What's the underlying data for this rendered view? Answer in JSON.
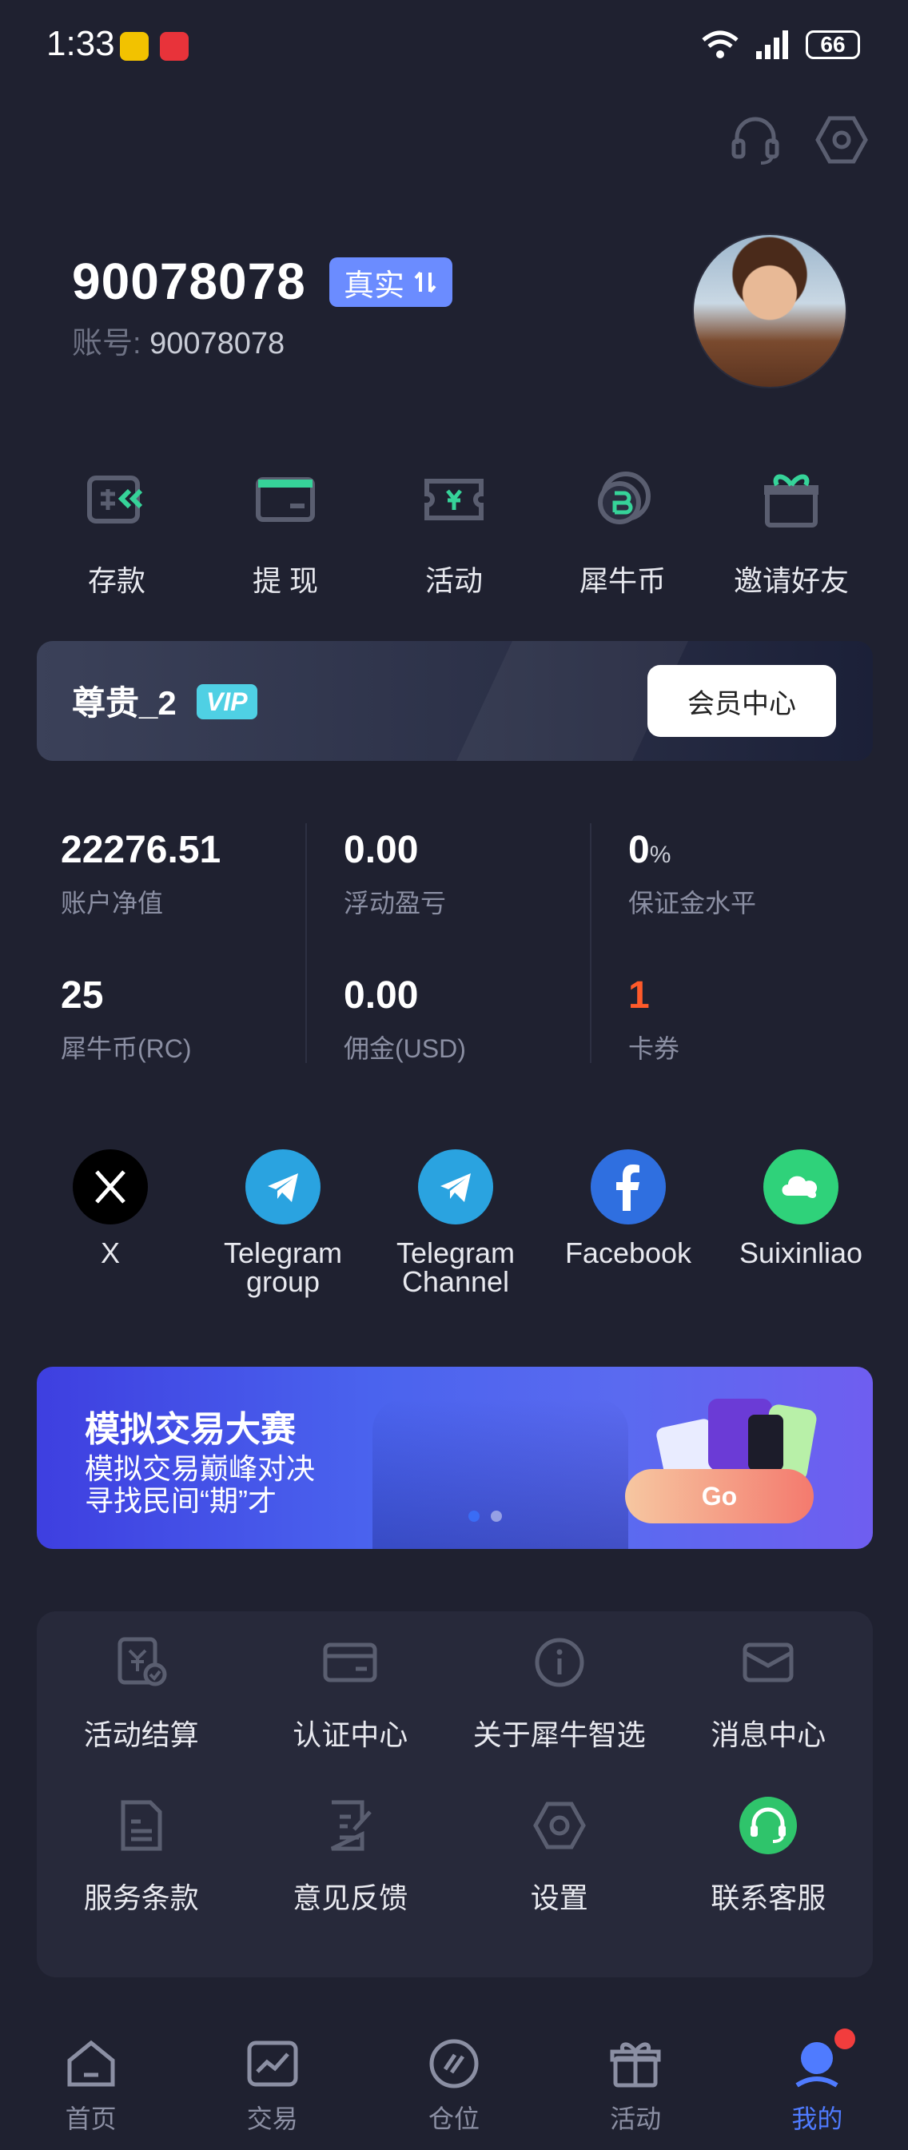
{
  "status_bar": {
    "time": "1:33",
    "battery": "66"
  },
  "profile": {
    "name": "90078078",
    "badge": "真实",
    "account_label": "账号:",
    "account_number": "90078078"
  },
  "quick_actions": [
    {
      "label": "存款",
      "icon": "deposit-icon"
    },
    {
      "label": "提 现",
      "icon": "wallet-icon"
    },
    {
      "label": "活动",
      "icon": "ticket-icon"
    },
    {
      "label": "犀牛币",
      "icon": "coin-icon"
    },
    {
      "label": "邀请好友",
      "icon": "gift-icon"
    }
  ],
  "vip": {
    "title": "尊贵_2",
    "badge": "VIP",
    "button": "会员中心"
  },
  "stats": [
    {
      "value": "22276.51",
      "unit": "",
      "label": "账户净值"
    },
    {
      "value": "0.00",
      "unit": "",
      "label": "浮动盈亏"
    },
    {
      "value": "0",
      "unit": "%",
      "label": "保证金水平"
    },
    {
      "value": "25",
      "unit": "",
      "label": "犀牛币(RC)"
    },
    {
      "value": "0.00",
      "unit": "",
      "label": "佣金(USD)"
    },
    {
      "value": "1",
      "unit": "",
      "label": "卡券"
    }
  ],
  "social": [
    {
      "label": "X",
      "icon": "x-icon"
    },
    {
      "label": "Telegram\ngroup",
      "icon": "telegram-icon"
    },
    {
      "label": "Telegram\nChannel",
      "icon": "telegram-icon"
    },
    {
      "label": "Facebook",
      "icon": "facebook-icon"
    },
    {
      "label": "Suixinliao",
      "icon": "chat-cloud-icon"
    }
  ],
  "contest": {
    "title": "模拟交易大赛",
    "line1": "模拟交易巅峰对决",
    "line2": "寻找民间“期”才",
    "button": "Go"
  },
  "menu": [
    {
      "label": "活动结算",
      "icon": "settlement-icon"
    },
    {
      "label": "认证中心",
      "icon": "card-icon"
    },
    {
      "label": "关于犀牛智选",
      "icon": "info-icon"
    },
    {
      "label": "消息中心",
      "icon": "mail-icon"
    },
    {
      "label": "服务条款",
      "icon": "document-icon"
    },
    {
      "label": "意见反馈",
      "icon": "feedback-icon"
    },
    {
      "label": "设置",
      "icon": "settings-icon"
    },
    {
      "label": "联系客服",
      "icon": "support-icon"
    }
  ],
  "nav": [
    {
      "label": "首页",
      "icon": "home-icon"
    },
    {
      "label": "交易",
      "icon": "chart-icon"
    },
    {
      "label": "仓位",
      "icon": "position-icon"
    },
    {
      "label": "活动",
      "icon": "gift-icon"
    },
    {
      "label": "我的",
      "icon": "profile-icon",
      "active": true
    }
  ],
  "colors": {
    "accent": "#4f7bff",
    "background": "#1f2130",
    "highlight": "#ff5a2a",
    "vip": "#4fd0e4"
  }
}
